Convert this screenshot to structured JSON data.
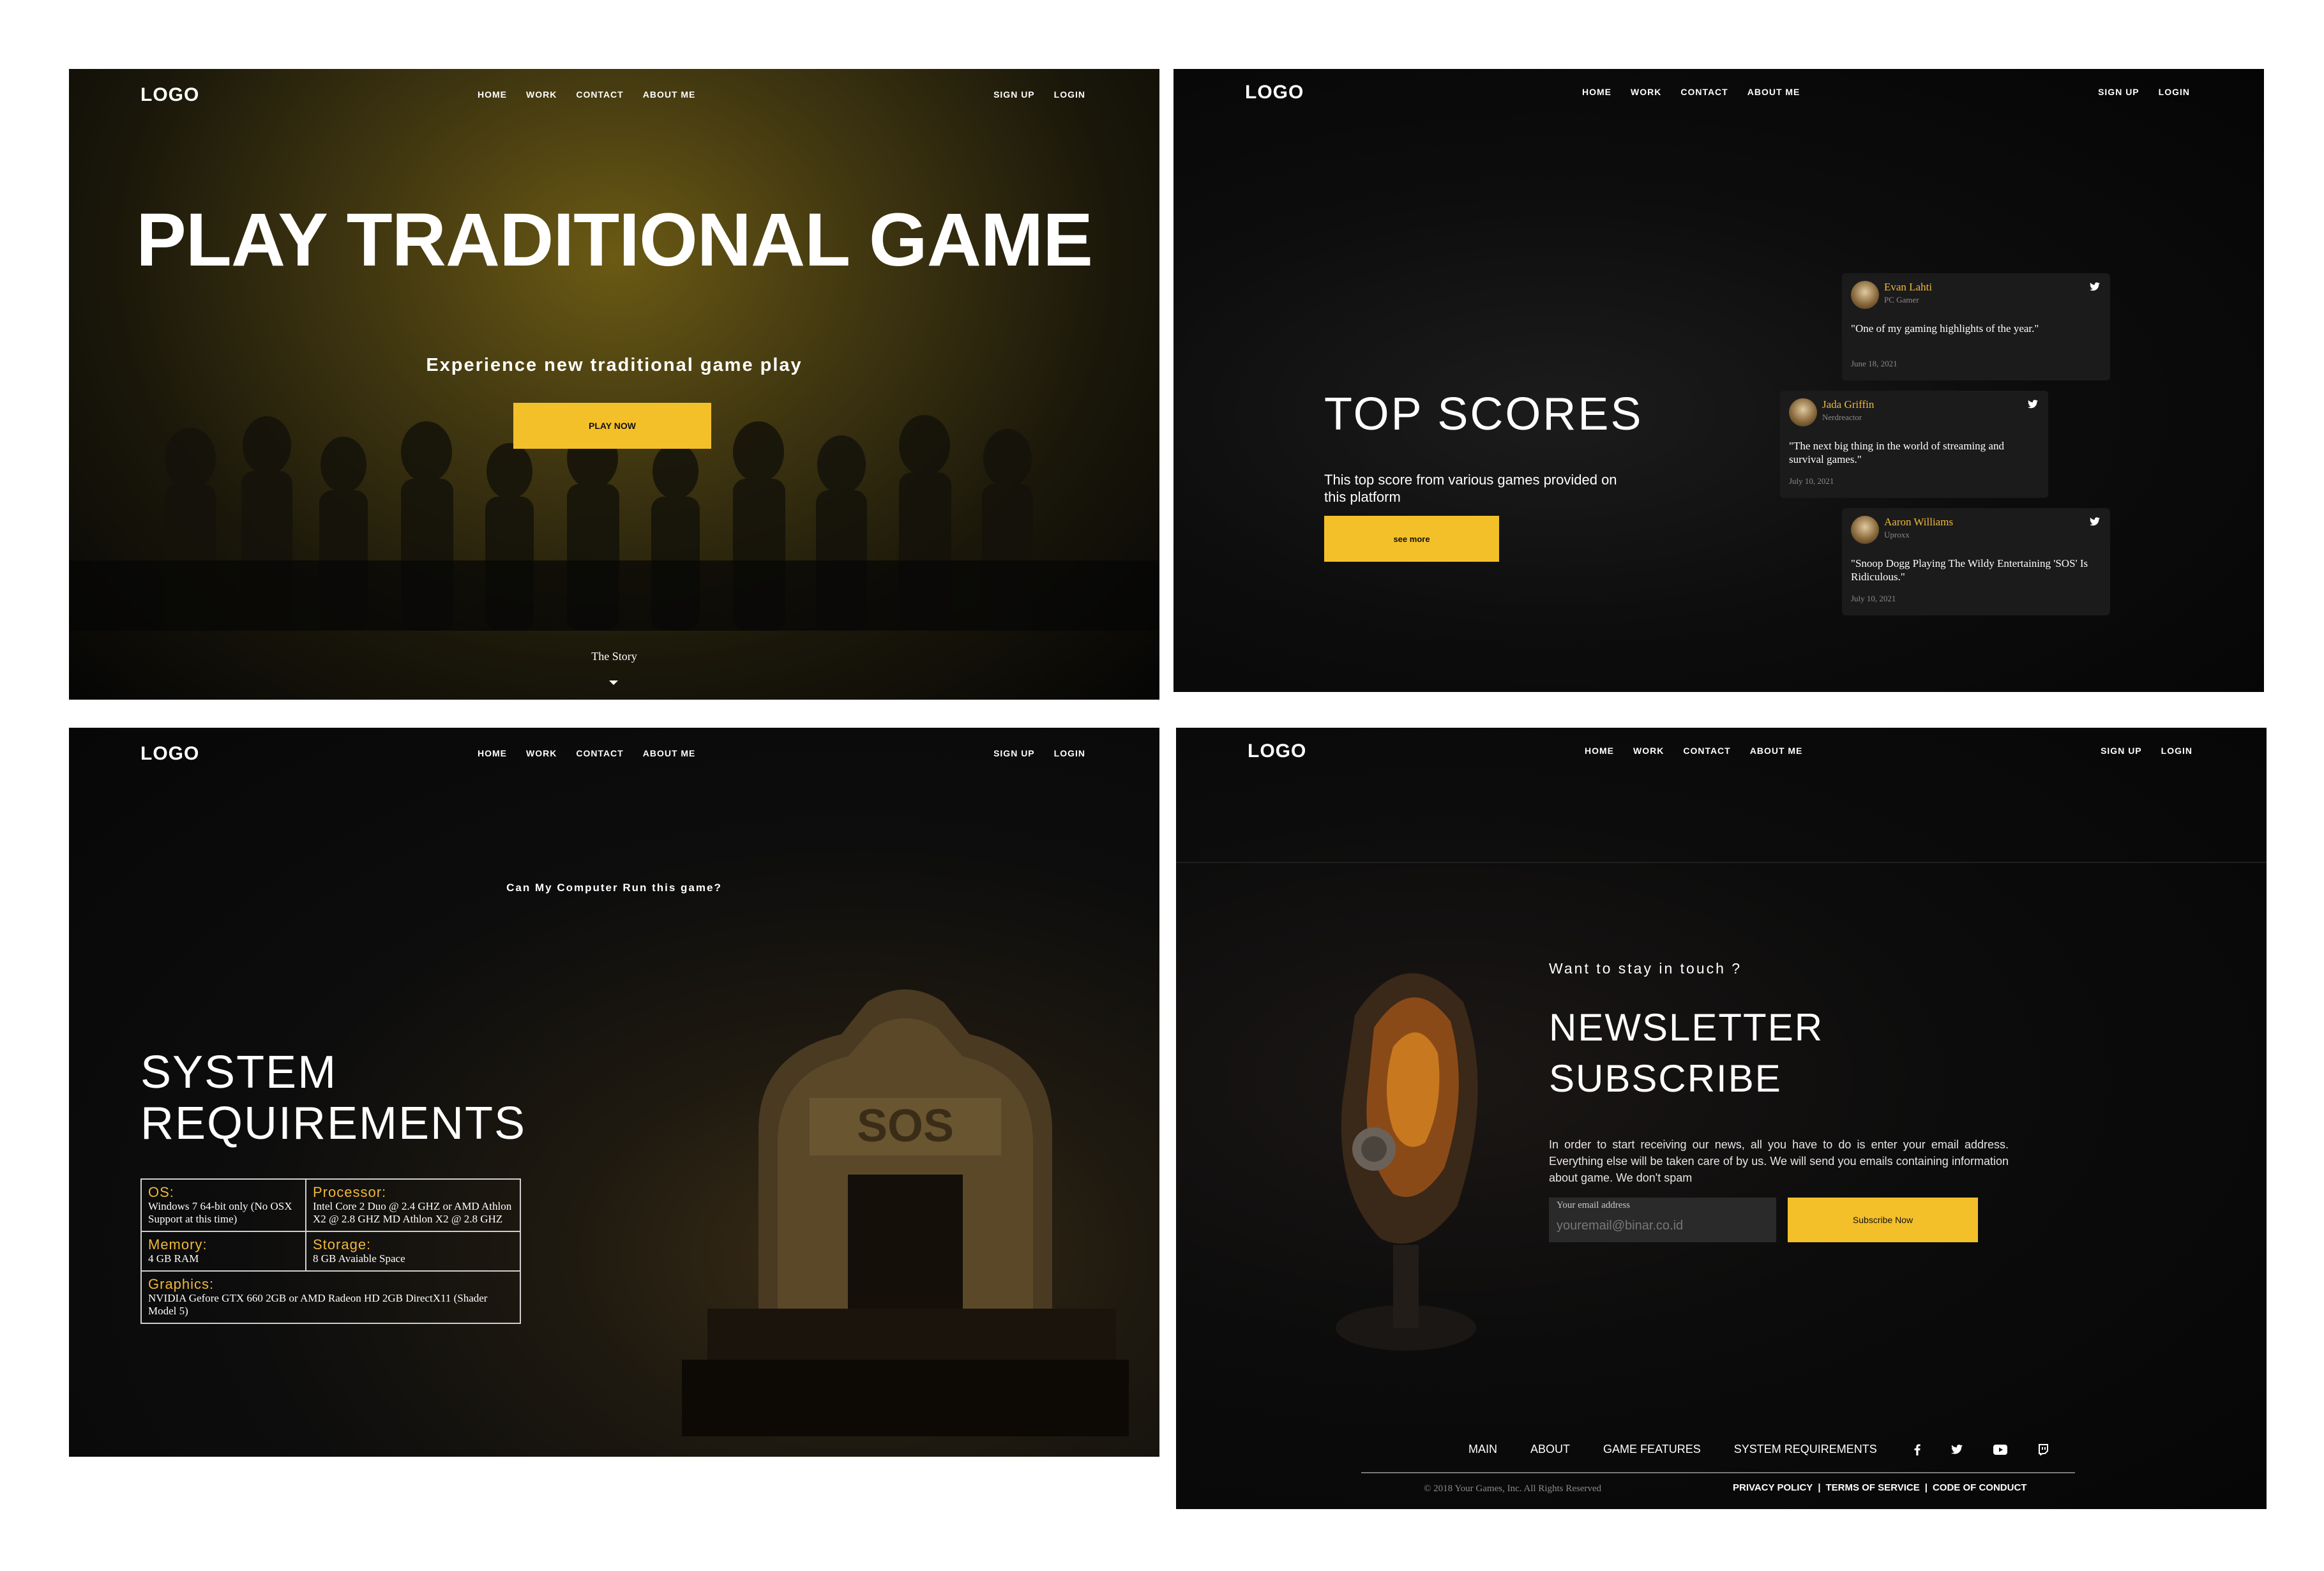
{
  "nav": {
    "logo": "LOGO",
    "links": [
      "HOME",
      "WORK",
      "CONTACT",
      "ABOUT ME"
    ],
    "auth": [
      "SIGN UP",
      "LOGIN"
    ]
  },
  "hero": {
    "title": "PLAY TRADITIONAL GAME",
    "subtitle": "Experience new traditional game play",
    "button": "PLAY NOW",
    "story_link": "The Story"
  },
  "top_scores": {
    "title": "TOP SCORES",
    "description": "This top score from various games provided on this platform",
    "button": "see more",
    "cards": [
      {
        "name": "Evan Lahti",
        "role": "PC Gamer",
        "quote": "\"One of my gaming highlights of the year.\"",
        "date": "June 18, 2021"
      },
      {
        "name": "Jada Griffin",
        "role": "Nerdreactor",
        "quote": "\"The next big thing in the world of streaming and survival games.\"",
        "date": "July 10, 2021"
      },
      {
        "name": "Aaron Williams",
        "role": "Uproxx",
        "quote": "\"Snoop Dogg Playing The Wildy Entertaining 'SOS' Is Ridiculous.\"",
        "date": "July 10, 2021"
      }
    ]
  },
  "system": {
    "question": "Can My Computer Run this game?",
    "title_line1": "SYSTEM",
    "title_line2": "REQUIREMENTS",
    "os_label": "OS:",
    "os_value": "Windows 7 64-bit only (No OSX Support at this time)",
    "processor_label": "Processor:",
    "processor_value": "Intel Core 2 Duo @ 2.4 GHZ or AMD Athlon X2 @ 2.8 GHZ MD Athlon X2 @ 2.8 GHZ",
    "memory_label": "Memory:",
    "memory_value": "4 GB RAM",
    "storage_label": "Storage:",
    "storage_value": "8 GB Avaiable Space",
    "graphics_label": "Graphics:",
    "graphics_value": "NVIDIA Gefore GTX 660 2GB or AMD Radeon HD 2GB DirectX11 (Shader Model 5)"
  },
  "newsletter": {
    "question": "Want to stay in touch ?",
    "title_line1": "NEWSLETTER",
    "title_line2": "SUBSCRIBE",
    "description": "In order to start receiving our news, all you have to do is enter your email address. Everything else will be taken care of by us. We will send you emails containing information about game. We don't spam",
    "email_label": "Your email address",
    "email_placeholder": "youremail@binar.co.id",
    "button": "Subscribe Now"
  },
  "footer": {
    "links": [
      "MAIN",
      "ABOUT",
      "GAME FEATURES",
      "SYSTEM REQUIREMENTS"
    ],
    "social_icons": [
      "facebook-icon",
      "twitter-icon",
      "youtube-icon",
      "twitch-icon"
    ],
    "copyright": "© 2018 Your Games, Inc. All Rights Reserved",
    "legal": [
      "PRIVACY POLICY",
      "|",
      "TERMS OF SERVICE",
      "|",
      "CODE OF CONDUCT"
    ]
  },
  "colors": {
    "accent": "#f4c02a",
    "name_gold": "#f0b83a",
    "background": "#0a0a0a"
  }
}
